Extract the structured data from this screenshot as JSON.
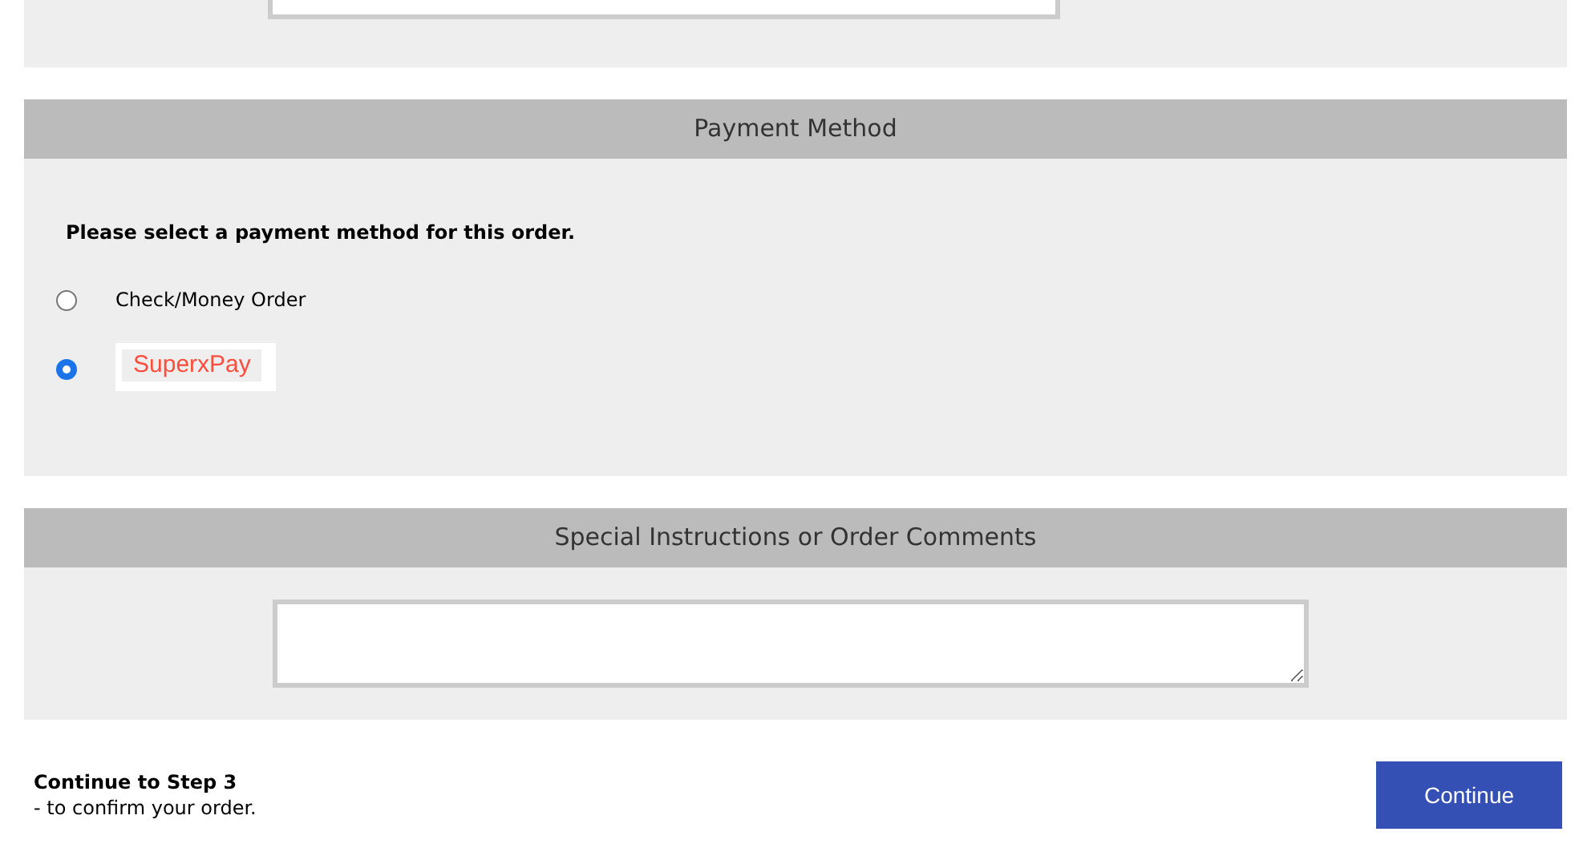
{
  "payment": {
    "title": "Payment Method",
    "prompt": "Please select a payment method for this order.",
    "options": [
      {
        "kind": "text",
        "label": "Check/Money Order",
        "selected": false
      },
      {
        "kind": "logo",
        "label": "SuperxPay",
        "selected": true
      }
    ]
  },
  "comments": {
    "title": "Special Instructions or Order Comments"
  },
  "footer": {
    "heading": "Continue to Step 3",
    "note": "- to confirm your order.",
    "button": "Continue"
  }
}
